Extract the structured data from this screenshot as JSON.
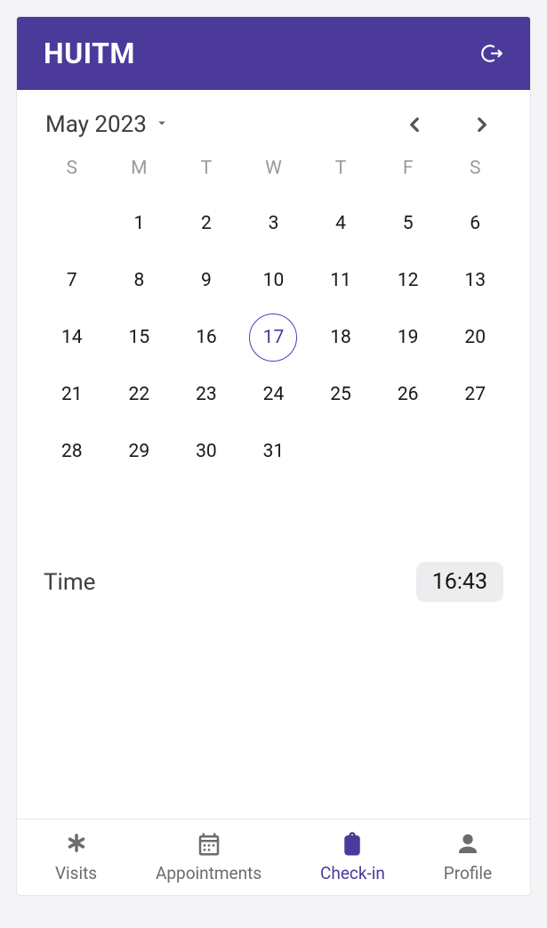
{
  "header": {
    "title": "HUITM"
  },
  "calendar": {
    "month_label": "May 2023",
    "weekdays": [
      "S",
      "M",
      "T",
      "W",
      "T",
      "F",
      "S"
    ],
    "blanks_before": 1,
    "days_in_month": 31,
    "selected_day": 17
  },
  "time": {
    "label": "Time",
    "value": "16:43"
  },
  "tabbar": {
    "visits": "Visits",
    "appointments": "Appointments",
    "checkin": "Check-in",
    "profile": "Profile",
    "active": "checkin"
  }
}
